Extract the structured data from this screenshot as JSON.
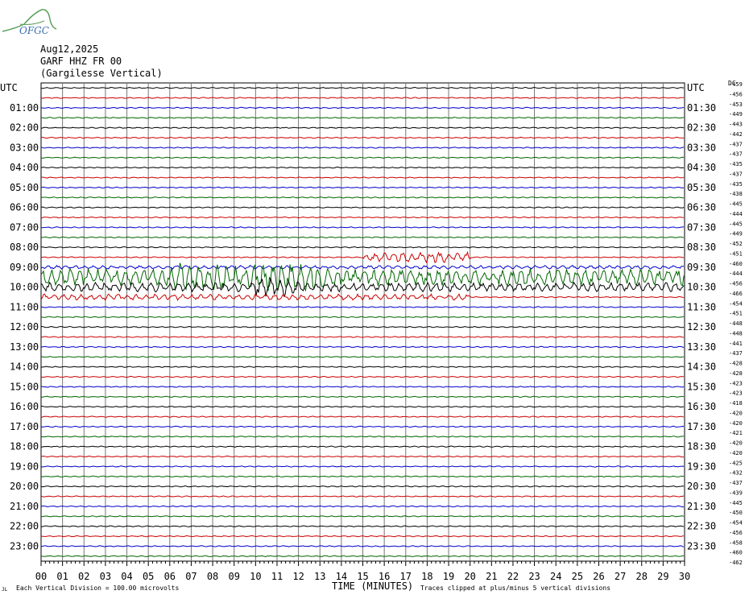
{
  "header": {
    "logo_text": "OFGC",
    "date": "Aug12,2025",
    "station_line": "GARF HHZ FR 00",
    "station_name": "(Gargilesse Vertical)"
  },
  "footer": {
    "corner_mark": "JL",
    "scale_note": "Each Vertical Division =  100.00 microvolts",
    "axis_title": "TIME (MINUTES)",
    "clip_note": "Traces clipped at plus/minus 5 vertical divisions"
  },
  "chart_data": {
    "type": "line",
    "title": "",
    "xlabel": "TIME (MINUTES)",
    "ylabel": "UTC",
    "right_ylabel": "UTC",
    "offset_label": "DC",
    "xlim": [
      0,
      30
    ],
    "x_ticks": [
      "00",
      "01",
      "02",
      "03",
      "04",
      "05",
      "06",
      "07",
      "08",
      "09",
      "10",
      "11",
      "12",
      "13",
      "14",
      "15",
      "16",
      "17",
      "18",
      "19",
      "20",
      "21",
      "22",
      "23",
      "24",
      "25",
      "26",
      "27",
      "28",
      "29",
      "30"
    ],
    "trace_minutes": 30,
    "grid": true,
    "colors": [
      "#000000",
      "#cc0000",
      "#0000cc",
      "#006600"
    ],
    "left_hour_labels": [
      "UTC",
      "01:00",
      "02:00",
      "03:00",
      "04:00",
      "05:00",
      "06:00",
      "07:00",
      "08:00",
      "09:00",
      "10:00",
      "11:00",
      "12:00",
      "13:00",
      "14:00",
      "15:00",
      "16:00",
      "17:00",
      "18:00",
      "19:00",
      "20:00",
      "21:00",
      "22:00",
      "23:00"
    ],
    "right_hour_labels": [
      "UTC",
      "01:30",
      "02:30",
      "03:30",
      "04:30",
      "05:30",
      "06:30",
      "07:30",
      "08:30",
      "09:30",
      "10:30",
      "11:30",
      "12:30",
      "13:30",
      "14:30",
      "15:30",
      "16:30",
      "17:30",
      "18:30",
      "19:30",
      "20:30",
      "21:30",
      "22:30",
      "23:30"
    ],
    "dc_offsets": [
      -459,
      -456,
      -453,
      -449,
      -443,
      -442,
      -437,
      -437,
      -435,
      -437,
      -435,
      -438,
      -445,
      -444,
      -445,
      -449,
      -452,
      -451,
      -460,
      -444,
      -456,
      -466,
      -454,
      -451,
      -448,
      -448,
      -441,
      -437,
      -428,
      -428,
      -423,
      -423,
      -418,
      -420,
      -420,
      -421,
      -420,
      -420,
      -425,
      -432,
      -437,
      -439,
      -445,
      -450,
      -454,
      -456,
      -458,
      -460,
      -462
    ],
    "traces": {
      "count": 48,
      "events": [
        {
          "trace": 17,
          "start_min": 15.0,
          "end_min": 20.0,
          "amp": 0.35
        },
        {
          "trace": 18,
          "start_min": 0.0,
          "end_min": 30.0,
          "amp": 0.12
        },
        {
          "trace": 19,
          "start_min": 0.0,
          "end_min": 30.0,
          "amp": 0.55
        },
        {
          "trace": 19,
          "start_min": 6.0,
          "end_min": 14.0,
          "amp": 0.95
        },
        {
          "trace": 19,
          "start_min": 14.0,
          "end_min": 20.0,
          "amp": 0.35
        },
        {
          "trace": 20,
          "start_min": 0.0,
          "end_min": 30.0,
          "amp": 0.3
        },
        {
          "trace": 20,
          "start_min": 10.0,
          "end_min": 12.0,
          "amp": 0.6
        },
        {
          "trace": 21,
          "start_min": 0.0,
          "end_min": 20.0,
          "amp": 0.2
        }
      ]
    }
  }
}
